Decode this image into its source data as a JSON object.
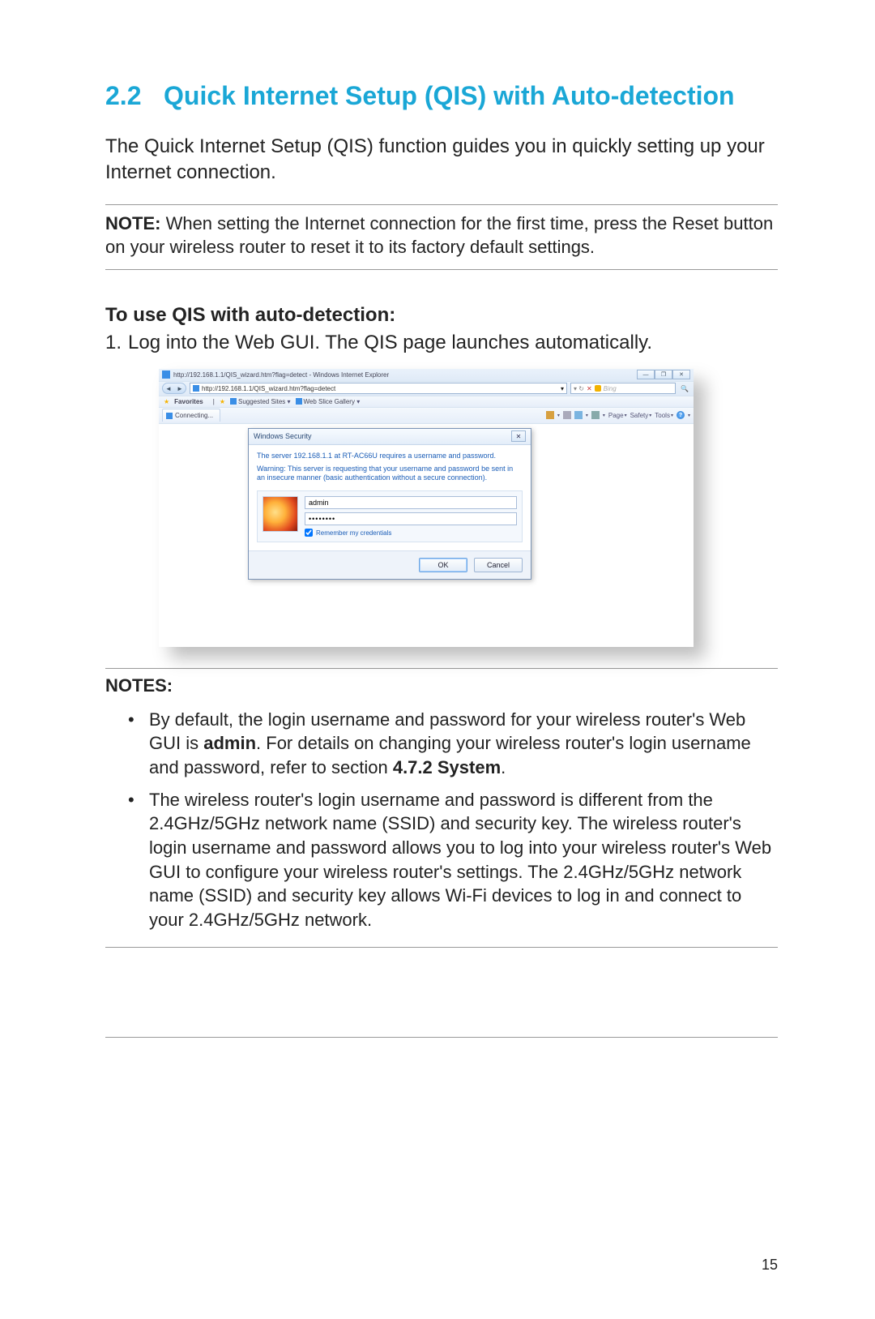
{
  "heading": {
    "number": "2.2",
    "title": "Quick Internet Setup (QIS) with Auto-detection"
  },
  "intro": "The Quick Internet Setup (QIS) function guides you in quickly setting up your Internet connection.",
  "note1": {
    "lead": "NOTE:",
    "body": "  When setting the Internet connection for the first time, press the Reset button on your wireless router to reset it to its factory default settings."
  },
  "subheading": "To use QIS with auto-detection:",
  "step1": {
    "n": "1.",
    "text": "Log into the Web GUI. The QIS page launches automatically."
  },
  "browser": {
    "window_title": "http://192.168.1.1/QIS_wizard.htm?flag=detect - Windows Internet Explorer",
    "url": "http://192.168.1.1/QIS_wizard.htm?flag=detect",
    "search_placeholder": "Bing",
    "fav_label": "Favorites",
    "suggested": "Suggested Sites",
    "webslice": "Web Slice Gallery",
    "tab_label": "Connecting...",
    "menus": {
      "page": "Page",
      "safety": "Safety",
      "tools": "Tools"
    },
    "window_buttons": {
      "min": "—",
      "max": "❐",
      "close": "✕"
    }
  },
  "dialog": {
    "title": "Windows Security",
    "server_msg": "The server 192.168.1.1 at RT-AC66U requires a username and password.",
    "warning": "Warning: This server is requesting that your username and password be sent in an insecure manner (basic authentication without a secure connection).",
    "username_value": "admin",
    "password_value": "••••••••",
    "remember": "Remember my credentials",
    "ok": "OK",
    "cancel": "Cancel"
  },
  "notes": {
    "lead": "NOTES:",
    "items": [
      {
        "pre": "By default, the login username and password for your wireless router's Web GUI is ",
        "bold1": "admin",
        "mid": ". For details on changing your wireless router's login username and password, refer to section ",
        "bold2": "4.7.2 System",
        "post": "."
      },
      {
        "text": "The wireless router's login username and password is different from the 2.4GHz/5GHz network name (SSID) and security key. The wireless router's login username and password allows you to log into your wireless router's Web GUI to configure your wireless router's settings. The 2.4GHz/5GHz network name (SSID) and security key allows Wi-Fi devices to log in and connect to your 2.4GHz/5GHz network."
      }
    ]
  },
  "page_number": "15"
}
